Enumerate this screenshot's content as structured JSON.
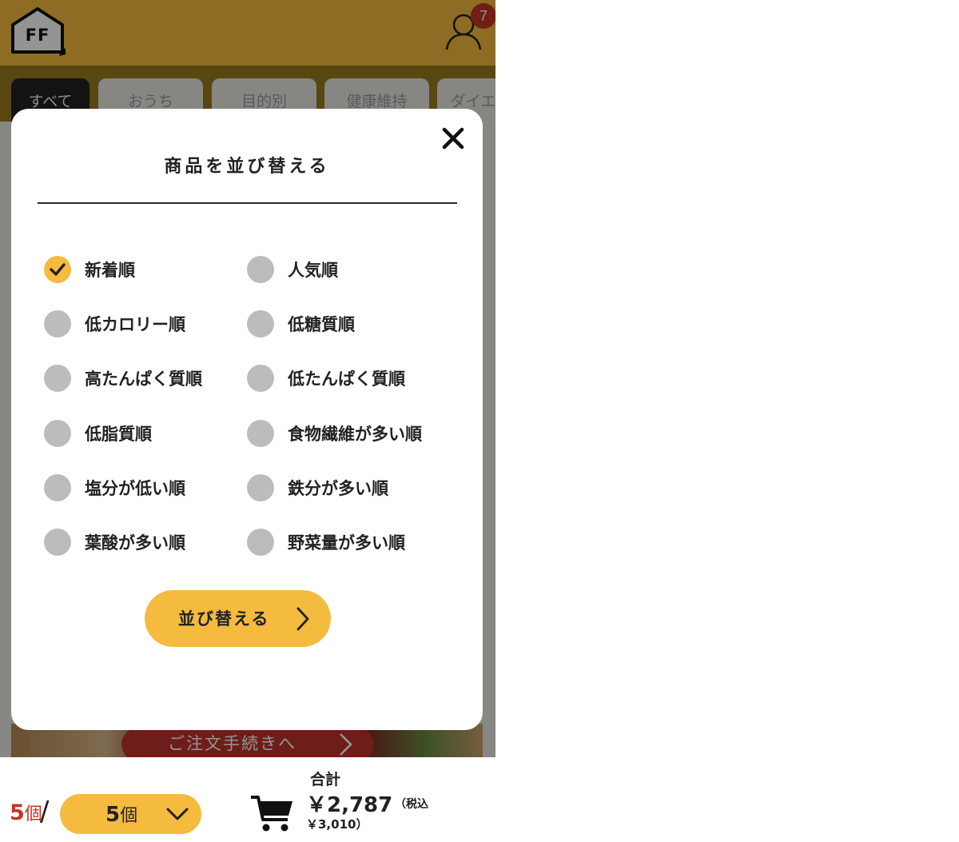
{
  "header": {
    "logo_text": "FF",
    "notification_count": "7",
    "colors": {
      "accent": "#f5bb3f",
      "badge": "#c63228"
    }
  },
  "tabs": [
    {
      "label": "すべて",
      "active": true
    },
    {
      "label": "おうち"
    },
    {
      "label": "目的別"
    },
    {
      "label": "健康維持"
    },
    {
      "label": "ダイエ"
    }
  ],
  "modal": {
    "title": "商品を並び替える",
    "close_icon": "close-icon",
    "options": [
      {
        "label": "新着順",
        "selected": true
      },
      {
        "label": "人気順",
        "selected": false
      },
      {
        "label": "低カロリー順",
        "selected": false
      },
      {
        "label": "低糖質順",
        "selected": false
      },
      {
        "label": "高たんぱく質順",
        "selected": false
      },
      {
        "label": "低たんぱく質順",
        "selected": false
      },
      {
        "label": "低脂質順",
        "selected": false
      },
      {
        "label": "食物繊維が多い順",
        "selected": false
      },
      {
        "label": "塩分が低い順",
        "selected": false
      },
      {
        "label": "鉄分が多い順",
        "selected": false
      },
      {
        "label": "葉酸が多い順",
        "selected": false
      },
      {
        "label": "野菜量が多い順",
        "selected": false
      }
    ],
    "submit_label": "並び替える"
  },
  "background": {
    "order_button_label": "ご注文手続きへ"
  },
  "footer": {
    "count": "5",
    "count_unit": "個",
    "slash": "/",
    "select_value": "5",
    "select_unit": "個",
    "total_label": "合計",
    "total_price": "￥2,787",
    "tax_note": "（税込",
    "total_incl": "￥3,010）"
  }
}
